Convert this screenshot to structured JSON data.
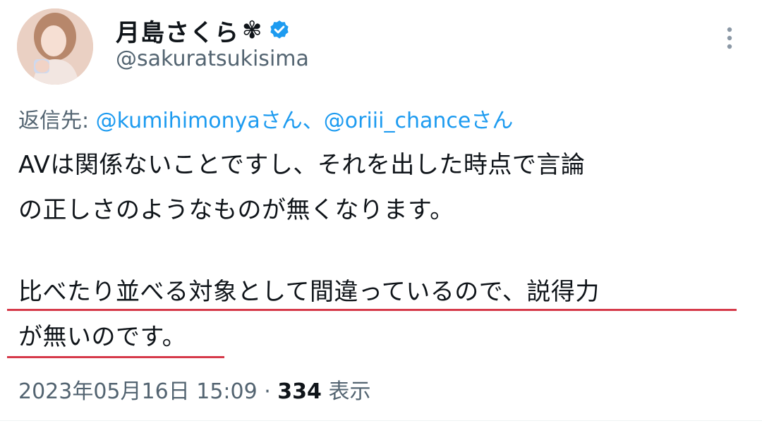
{
  "author": {
    "display_name": "月島さくら",
    "name_symbol": "✾",
    "handle": "@sakuratsukisima",
    "verified": true
  },
  "reply": {
    "prefix": "返信先: ",
    "mention_1": "@kumihimonya",
    "suffix_1": "さん、",
    "mention_2": "@oriii_chance",
    "suffix_2": "さん"
  },
  "body": {
    "line_1": "AVは関係ないことですし、それを出した時点で言論",
    "line_2": "の正しさのようなものが無くなります。",
    "line_3": "比べたり並べる対象として間違っているので、説得力",
    "line_4": "が無いのです。"
  },
  "meta": {
    "timestamp": "2023年05月16日 15:09",
    "separator": " · ",
    "views_count": "334",
    "views_label": " 表示"
  },
  "colors": {
    "accent": "#1d9bf0",
    "text": "#0f1419",
    "secondary": "#536471",
    "underline": "#d63a4a"
  },
  "icons": {
    "more": "more-vertical-icon",
    "verified": "verified-badge-icon"
  }
}
